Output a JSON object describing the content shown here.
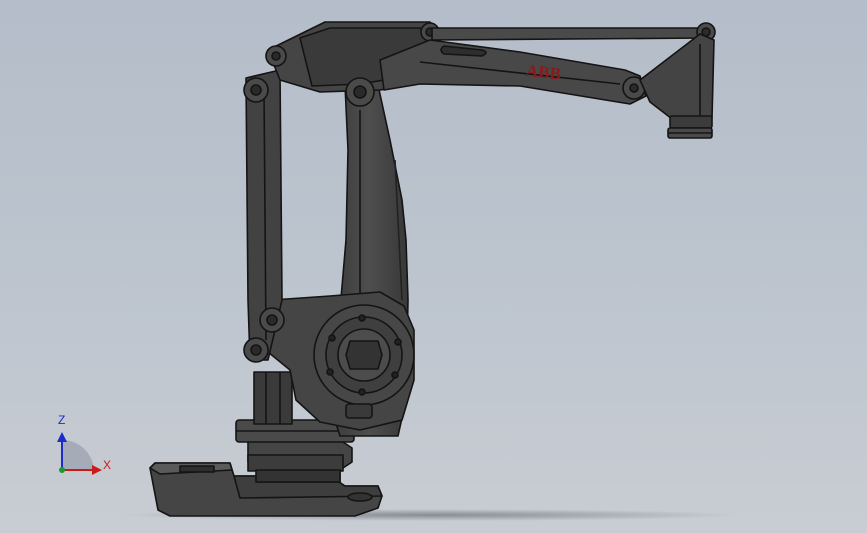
{
  "viewport": {
    "background_top": "#b4bdc9",
    "background_bottom": "#c9cdd3"
  },
  "model": {
    "logo_text": "ABB",
    "logo_color": "#8a1a1a",
    "body_color": "#454545",
    "edge_color": "#141414"
  },
  "triad": {
    "z_label": "Z",
    "x_label": "X",
    "z_color": "#1a2ccc",
    "x_color": "#cc1a1a",
    "y_color": "#1a9a2a"
  }
}
